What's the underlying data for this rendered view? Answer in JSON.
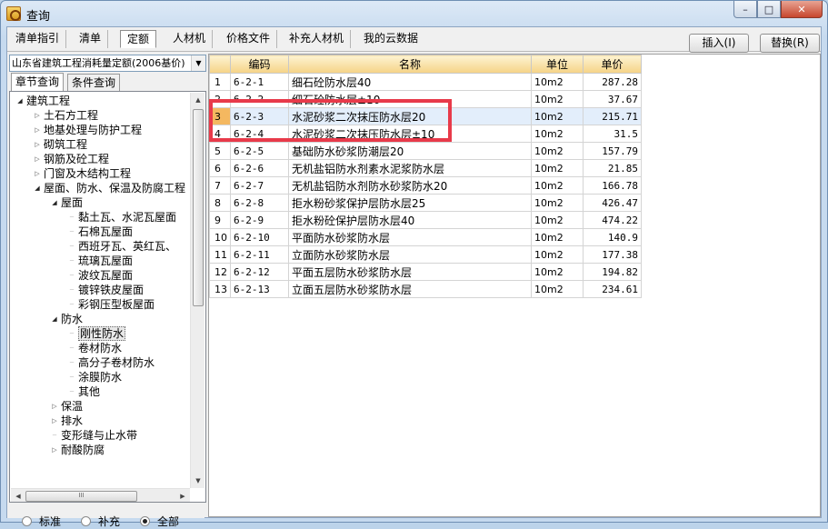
{
  "window": {
    "title": "查询"
  },
  "tabs": [
    {
      "label": "清单指引"
    },
    {
      "label": "清单"
    },
    {
      "label": "定额"
    },
    {
      "label": "人材机"
    },
    {
      "label": "价格文件"
    },
    {
      "label": "补充人材机"
    },
    {
      "label": "我的云数据"
    }
  ],
  "active_tab": "定额",
  "actions": {
    "insert_label": "插入(I)",
    "replace_label": "替换(R)"
  },
  "left_panel": {
    "library_select": "山东省建筑工程消耗量定额(2006基价)",
    "subtabs": [
      {
        "label": "章节查询"
      },
      {
        "label": "条件查询"
      }
    ],
    "tree": [
      {
        "label": "建筑工程",
        "level": 0,
        "state": "open"
      },
      {
        "label": "土石方工程",
        "level": 1,
        "state": "closed"
      },
      {
        "label": "地基处理与防护工程",
        "level": 1,
        "state": "closed"
      },
      {
        "label": "砌筑工程",
        "level": 1,
        "state": "closed"
      },
      {
        "label": "钢筋及砼工程",
        "level": 1,
        "state": "closed"
      },
      {
        "label": "门窗及木结构工程",
        "level": 1,
        "state": "closed"
      },
      {
        "label": "屋面、防水、保温及防腐工程",
        "level": 1,
        "state": "open"
      },
      {
        "label": "屋面",
        "level": 2,
        "state": "open"
      },
      {
        "label": "黏土瓦、水泥瓦屋面",
        "level": 3,
        "state": "leaf"
      },
      {
        "label": "石棉瓦屋面",
        "level": 3,
        "state": "leaf"
      },
      {
        "label": "西班牙瓦、英红瓦、",
        "level": 3,
        "state": "leaf"
      },
      {
        "label": "琉璃瓦屋面",
        "level": 3,
        "state": "leaf"
      },
      {
        "label": "波纹瓦屋面",
        "level": 3,
        "state": "leaf"
      },
      {
        "label": "镀锌铁皮屋面",
        "level": 3,
        "state": "leaf"
      },
      {
        "label": "彩钢压型板屋面",
        "level": 3,
        "state": "leaf"
      },
      {
        "label": "防水",
        "level": 2,
        "state": "open"
      },
      {
        "label": "刚性防水",
        "level": 3,
        "state": "leaf",
        "selected": true
      },
      {
        "label": "卷材防水",
        "level": 3,
        "state": "leaf"
      },
      {
        "label": "高分子卷材防水",
        "level": 3,
        "state": "leaf"
      },
      {
        "label": "涂膜防水",
        "level": 3,
        "state": "leaf"
      },
      {
        "label": "其他",
        "level": 3,
        "state": "leaf"
      },
      {
        "label": "保温",
        "level": 2,
        "state": "closed"
      },
      {
        "label": "排水",
        "level": 2,
        "state": "closed"
      },
      {
        "label": "变形缝与止水带",
        "level": 2,
        "state": "leaf"
      },
      {
        "label": "耐酸防腐",
        "level": 2,
        "state": "closed"
      }
    ],
    "hscroll_label": "III",
    "radios": [
      {
        "label": "标准",
        "checked": false
      },
      {
        "label": "补充",
        "checked": false
      },
      {
        "label": "全部",
        "checked": true
      }
    ]
  },
  "grid": {
    "columns": [
      {
        "label": ""
      },
      {
        "label": "编码"
      },
      {
        "label": "名称"
      },
      {
        "label": "单位"
      },
      {
        "label": "单价"
      }
    ],
    "rows": [
      {
        "n": "1",
        "code": "6-2-1",
        "name": "细石砼防水层40",
        "unit": "10m2",
        "price": "287.28"
      },
      {
        "n": "2",
        "code": "6-2-2",
        "name": "细石砼防水层±10",
        "unit": "10m2",
        "price": "37.67"
      },
      {
        "n": "3",
        "code": "6-2-3",
        "name": "水泥砂浆二次抹压防水层20",
        "unit": "10m2",
        "price": "215.71"
      },
      {
        "n": "4",
        "code": "6-2-4",
        "name": "水泥砂浆二次抹压防水层±10",
        "unit": "10m2",
        "price": "31.5"
      },
      {
        "n": "5",
        "code": "6-2-5",
        "name": "基础防水砂浆防潮层20",
        "unit": "10m2",
        "price": "157.79"
      },
      {
        "n": "6",
        "code": "6-2-6",
        "name": "无机盐铝防水剂素水泥浆防水层",
        "unit": "10m2",
        "price": "21.85"
      },
      {
        "n": "7",
        "code": "6-2-7",
        "name": "无机盐铝防水剂防水砂浆防水20",
        "unit": "10m2",
        "price": "166.78"
      },
      {
        "n": "8",
        "code": "6-2-8",
        "name": "拒水粉砂浆保护层防水层25",
        "unit": "10m2",
        "price": "426.47"
      },
      {
        "n": "9",
        "code": "6-2-9",
        "name": "拒水粉砼保护层防水层40",
        "unit": "10m2",
        "price": "474.22"
      },
      {
        "n": "10",
        "code": "6-2-10",
        "name": "平面防水砂浆防水层",
        "unit": "10m2",
        "price": "140.9"
      },
      {
        "n": "11",
        "code": "6-2-11",
        "name": "立面防水砂浆防水层",
        "unit": "10m2",
        "price": "177.38"
      },
      {
        "n": "12",
        "code": "6-2-12",
        "name": "平面五层防水砂浆防水层",
        "unit": "10m2",
        "price": "194.82"
      },
      {
        "n": "13",
        "code": "6-2-13",
        "name": "立面五层防水砂浆防水层",
        "unit": "10m2",
        "price": "234.61"
      }
    ],
    "selected_row": "3"
  },
  "colors": {
    "highlight_box": "#e83a4a",
    "header_bg": "#f5d386",
    "selected_row_number": "#f4b860"
  }
}
